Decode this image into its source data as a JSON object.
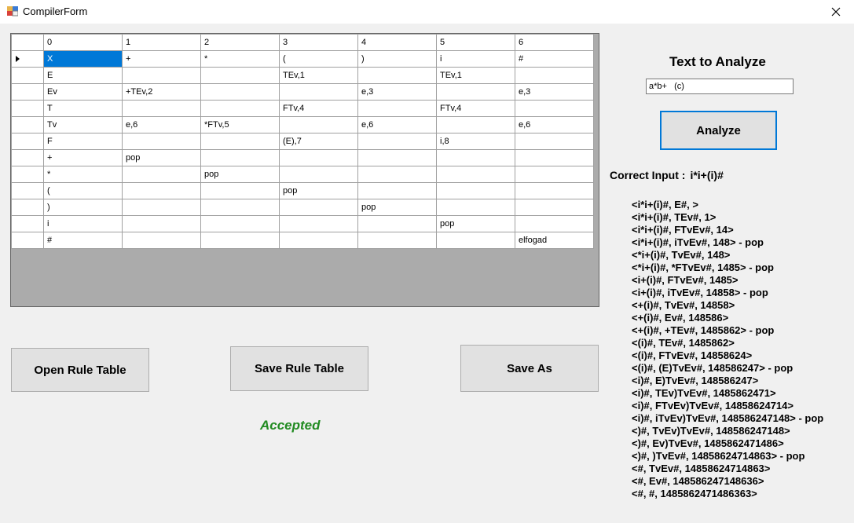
{
  "window": {
    "title": "CompilerForm"
  },
  "grid": {
    "columns": [
      "0",
      "1",
      "2",
      "3",
      "4",
      "5",
      "6"
    ],
    "rows": [
      [
        "X",
        "+",
        "*",
        "(",
        ")",
        "i",
        "#"
      ],
      [
        "E",
        "",
        "",
        "TEv,1",
        "",
        "TEv,1",
        ""
      ],
      [
        "Ev",
        "+TEv,2",
        "",
        "",
        "e,3",
        "",
        "e,3"
      ],
      [
        "T",
        "",
        "",
        "FTv,4",
        "",
        "FTv,4",
        ""
      ],
      [
        "Tv",
        "e,6",
        "*FTv,5",
        "",
        "e,6",
        "",
        "e,6"
      ],
      [
        "F",
        "",
        "",
        "(E),7",
        "",
        "i,8",
        ""
      ],
      [
        "+",
        "pop",
        "",
        "",
        "",
        "",
        ""
      ],
      [
        "*",
        "",
        "pop",
        "",
        "",
        "",
        ""
      ],
      [
        "(",
        "",
        "",
        "pop",
        "",
        "",
        ""
      ],
      [
        ")",
        "",
        "",
        "",
        "pop",
        "",
        ""
      ],
      [
        "i",
        "",
        "",
        "",
        "",
        "pop",
        ""
      ],
      [
        "#",
        "",
        "",
        "",
        "",
        "",
        "elfogad"
      ]
    ]
  },
  "analyze": {
    "label": "Text to Analyze",
    "input_value": "a*b+   (c)",
    "button": "Analyze"
  },
  "buttons": {
    "open": "Open Rule Table",
    "save_table": "Save Rule Table",
    "save_as": "Save As"
  },
  "result": {
    "correct_label": "Correct Input :",
    "correct_value": "i*i+(i)#",
    "status": "Accepted",
    "status_color": "#228b22",
    "steps": [
      "<i*i+(i)#, E#, >",
      "<i*i+(i)#, TEv#, 1>",
      "<i*i+(i)#, FTvEv#, 14>",
      "<i*i+(i)#, iTvEv#, 148> - pop",
      "<*i+(i)#, TvEv#, 148>",
      "<*i+(i)#, *FTvEv#, 1485> - pop",
      "<i+(i)#, FTvEv#, 1485>",
      "<i+(i)#, iTvEv#, 14858> - pop",
      "<+(i)#, TvEv#, 14858>",
      "<+(i)#, Ev#, 148586>",
      "<+(i)#, +TEv#, 1485862> - pop",
      "<(i)#, TEv#, 1485862>",
      "<(i)#, FTvEv#, 14858624>",
      "<(i)#, (E)TvEv#, 148586247> - pop",
      "<i)#, E)TvEv#, 148586247>",
      "<i)#, TEv)TvEv#, 1485862471>",
      "<i)#, FTvEv)TvEv#, 14858624714>",
      "<i)#, iTvEv)TvEv#, 148586247148> - pop",
      "<)#, TvEv)TvEv#, 148586247148>",
      "<)#, Ev)TvEv#, 1485862471486>",
      "<)#, )TvEv#, 14858624714863> - pop",
      "<#, TvEv#, 14858624714863>",
      "<#, Ev#, 148586247148636>",
      "<#, #, 1485862471486363>"
    ]
  }
}
